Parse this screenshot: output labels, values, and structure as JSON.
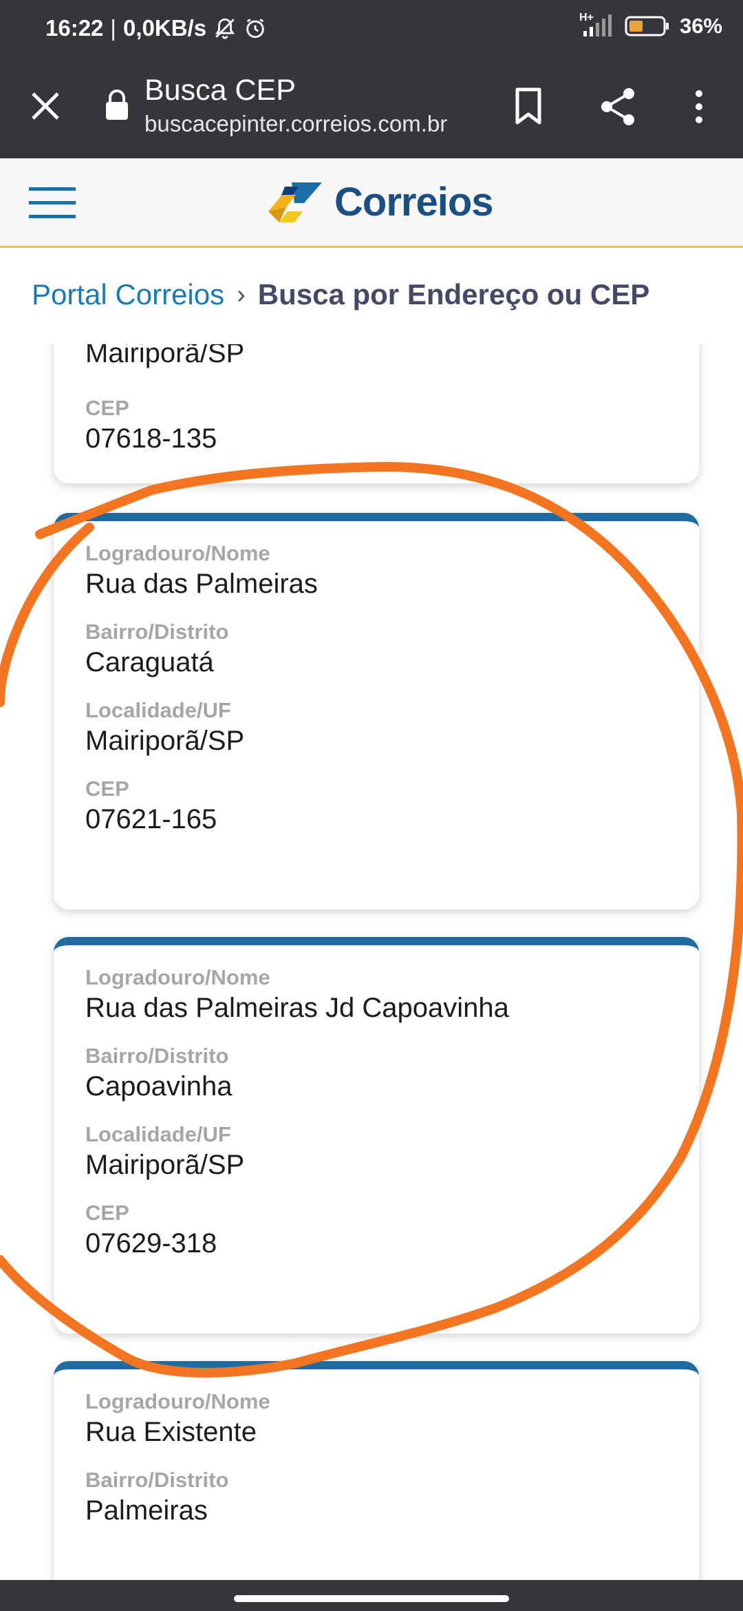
{
  "status_bar": {
    "time": "16:22",
    "network_speed": "0,0KB/s",
    "network_type": "H+",
    "battery": "36%",
    "colors": {
      "background": "#34363b",
      "battery_fill": "#e8a33a"
    }
  },
  "browser": {
    "page_title": "Busca CEP",
    "url": "buscacepinter.correios.com.br"
  },
  "site": {
    "logo_text": "Correios",
    "colors": {
      "brand_blue": "#1b4e83",
      "brand_yellow": "#f2c81d",
      "card_accent": "#1f6ca3",
      "annotation": "#f47521"
    }
  },
  "breadcrumb": {
    "portal": "Portal Correios",
    "separator": "›",
    "current": "Busca por Endereço ou CEP"
  },
  "results": [
    {
      "localidade_value": "Mairiporã/SP",
      "cep_label": "CEP",
      "cep": "07618-135"
    },
    {
      "logradouro_label": "Logradouro/Nome",
      "logradouro": "Rua das Palmeiras",
      "bairro_label": "Bairro/Distrito",
      "bairro": "Caraguatá",
      "localidade_label": "Localidade/UF",
      "localidade": "Mairiporã/SP",
      "cep_label": "CEP",
      "cep": "07621-165"
    },
    {
      "logradouro_label": "Logradouro/Nome",
      "logradouro": "Rua das Palmeiras Jd Capoavinha",
      "bairro_label": "Bairro/Distrito",
      "bairro": "Capoavinha",
      "localidade_label": "Localidade/UF",
      "localidade": "Mairiporã/SP",
      "cep_label": "CEP",
      "cep": "07629-318"
    },
    {
      "logradouro_label": "Logradouro/Nome",
      "logradouro": "Rua Existente",
      "bairro_label": "Bairro/Distrito",
      "bairro": "Palmeiras"
    }
  ]
}
